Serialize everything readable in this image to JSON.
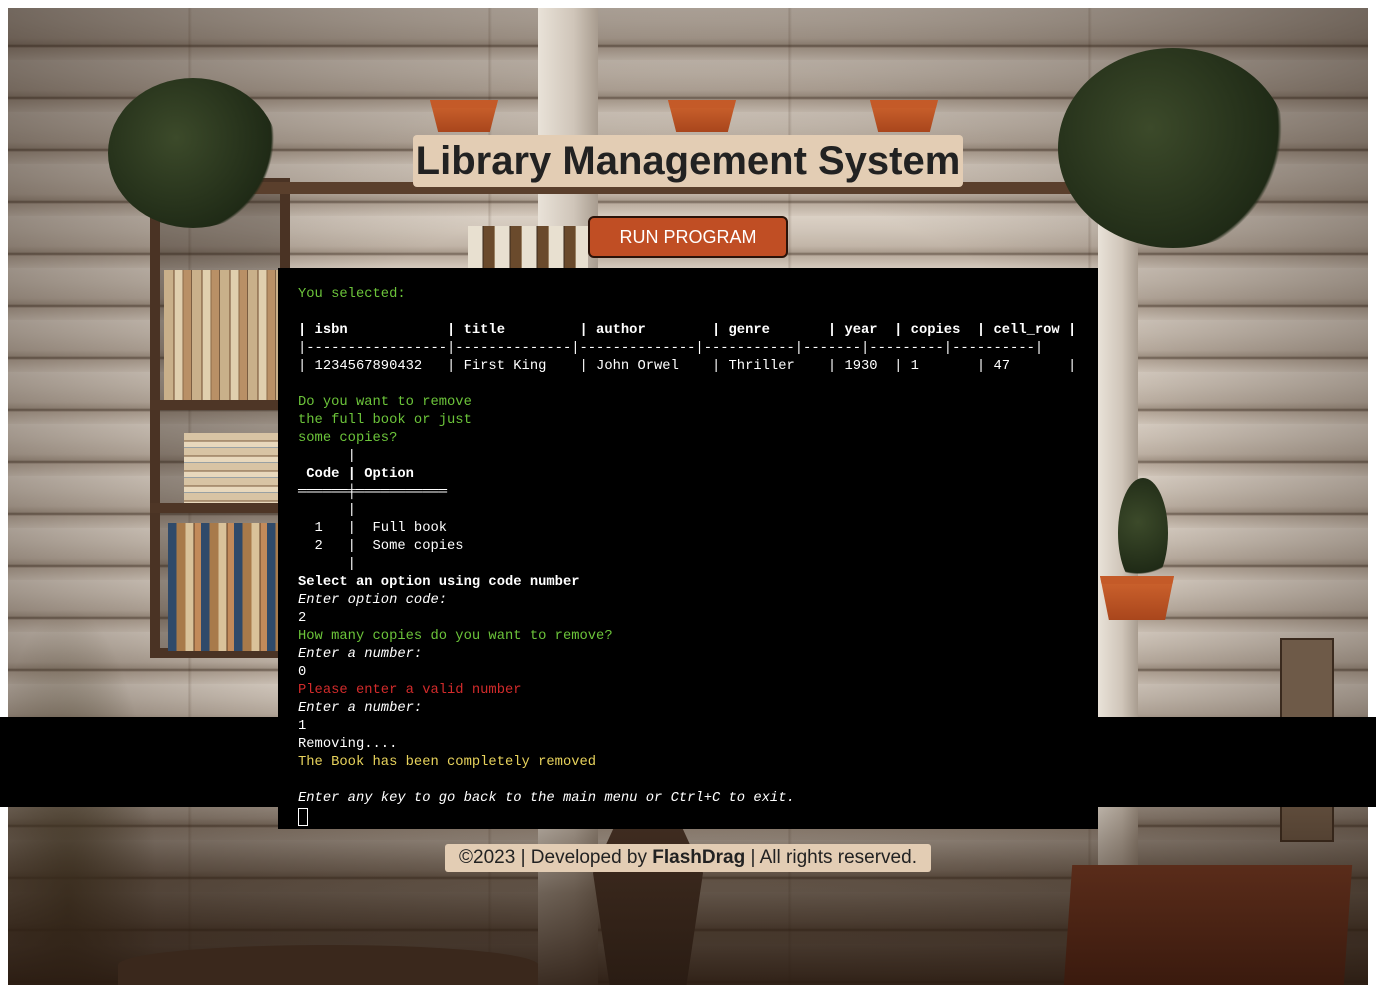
{
  "header": {
    "title": "Library Management System",
    "run_button_label": "RUN PROGRAM"
  },
  "terminal": {
    "you_selected": "You selected:",
    "table": {
      "header_row": "| isbn            | title         | author        | genre       | year  | copies  | cell_row |",
      "separator_row": "|-----------------|--------------|--------------|-----------|-------|---------|----------|",
      "data_row": "| 1234567890432   | First King    | John Orwel    | Thriller    | 1930  | 1       | 47       |"
    },
    "question_lines": [
      "Do you want to remove",
      "the full book or just",
      "some copies?"
    ],
    "options_table": {
      "top_line": "      |",
      "header_line": " Code | Option",
      "rule_line": "══════╪═══════════",
      "blank_line": "      |",
      "rows": [
        "  1   |  Full book",
        "  2   |  Some copies"
      ],
      "bottom_line": "      |"
    },
    "select_prompt": "Select an option using code number",
    "enter_option_code": "Enter option code:",
    "option_entered": "2",
    "how_many_prompt": "How many copies do you want to remove?",
    "enter_number_1": "Enter a number:",
    "number_entered_1": "0",
    "invalid_message": "Please enter a valid number",
    "enter_number_2": "Enter a number:",
    "number_entered_2": "1",
    "removing": "Removing....",
    "removed_message": "The Book has been completely removed",
    "exit_prompt": "Enter any key to go back to the main menu or Ctrl+C to exit."
  },
  "footer": {
    "prefix": "©2023 | Developed by ",
    "author": "FlashDrag",
    "suffix": " | All rights reserved."
  },
  "colors": {
    "title_bg": "#e3cdb4",
    "button_bg": "#c04e24",
    "terminal_bg": "#000000",
    "terminal_green": "#6cc43a",
    "terminal_red": "#d22b2b",
    "terminal_yellow": "#e8d35c"
  }
}
